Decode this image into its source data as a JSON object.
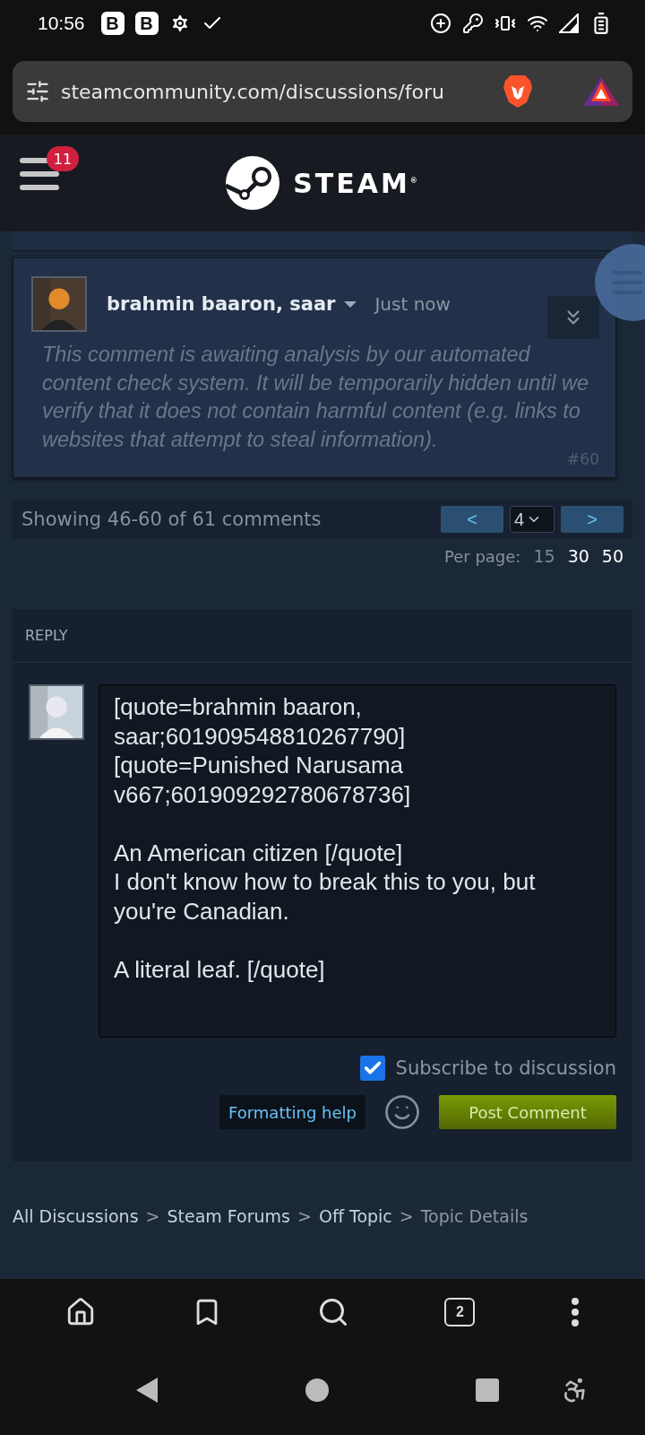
{
  "status_bar": {
    "time": "10:56",
    "app_icons": [
      "B",
      "B"
    ]
  },
  "address_bar": {
    "url": "steamcommunity.com/discussions/foru"
  },
  "header": {
    "notification_count": "11",
    "logo_text": "STEAM",
    "logo_mark": "®"
  },
  "comment": {
    "author": "brahmin baaron, saar",
    "time": "Just now",
    "body": "This comment is awaiting analysis by our automated content check system. It will be temporarily hidden until we verify that it does not contain harmful content (e.g. links to websites that attempt to steal information).",
    "number": "#60"
  },
  "pagination": {
    "summary": "Showing 46-60 of 61 comments",
    "prev": "<",
    "page": "4",
    "next": ">",
    "per_page_label": "Per page:",
    "per_page_options": [
      {
        "label": "15",
        "selected": true
      },
      {
        "label": "30",
        "selected": false
      },
      {
        "label": "50",
        "selected": false
      }
    ]
  },
  "reply": {
    "heading": "REPLY",
    "text": "[quote=brahmin baaron, saar;601909548810267790]\n[quote=Punished Narusama v667;601909292780678736]\n\nAn American citizen [/quote]\nI don't know how to break this to you, but you're Canadian.\n\nA literal leaf. [/quote]",
    "subscribe": {
      "label": "Subscribe to discussion",
      "checked": true
    },
    "formatting_help": "Formatting help",
    "post_button": "Post Comment"
  },
  "breadcrumbs": {
    "separator": ">",
    "items": [
      {
        "label": "All Discussions",
        "current": false
      },
      {
        "label": "Steam Forums",
        "current": false
      },
      {
        "label": "Off Topic",
        "current": false
      },
      {
        "label": "Topic Details",
        "current": true
      }
    ]
  },
  "browser_toolbar": {
    "tab_count": "2"
  }
}
